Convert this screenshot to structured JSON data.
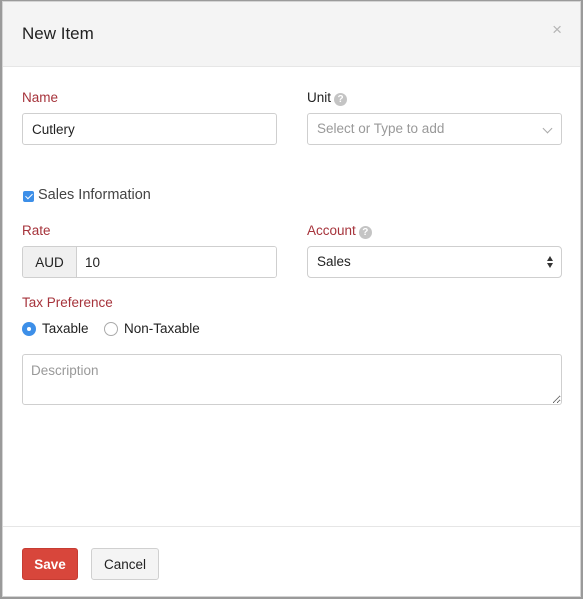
{
  "modal": {
    "title": "New Item",
    "close_icon": "×"
  },
  "form": {
    "name": {
      "label": "Name",
      "value": "Cutlery"
    },
    "unit": {
      "label": "Unit",
      "help_icon": "?",
      "placeholder": "Select or Type to add"
    },
    "sales_information": {
      "label": "Sales Information",
      "checked": true
    },
    "rate": {
      "label": "Rate",
      "currency": "AUD",
      "value": "10"
    },
    "account": {
      "label": "Account",
      "help_icon": "?",
      "selected": "Sales"
    },
    "tax_preference": {
      "label": "Tax Preference",
      "options": [
        {
          "label": "Taxable",
          "checked": true
        },
        {
          "label": "Non-Taxable",
          "checked": false
        }
      ]
    },
    "description": {
      "placeholder": "Description",
      "value": ""
    }
  },
  "footer": {
    "save_label": "Save",
    "cancel_label": "Cancel"
  },
  "colors": {
    "label_accent": "#a6333b",
    "primary_button": "#d8463b",
    "checkbox_radio": "#3d8fe8"
  }
}
